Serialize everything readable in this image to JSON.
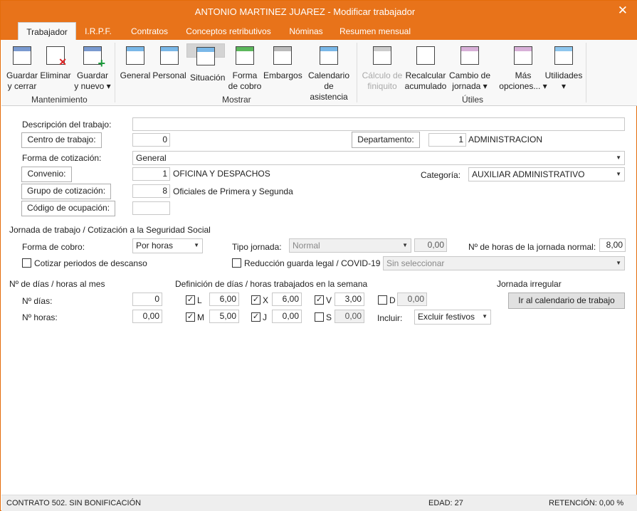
{
  "window": {
    "title": "ANTONIO MARTINEZ JUAREZ - Modificar trabajador",
    "close": "✕"
  },
  "tabs": [
    "Trabajador",
    "I.R.P.F.",
    "Contratos",
    "Conceptos retributivos",
    "Nóminas",
    "Resumen mensual"
  ],
  "ribbon": {
    "groups": [
      "Mantenimiento",
      "Mostrar",
      "Útiles"
    ],
    "buttons": [
      {
        "l1": "Guardar",
        "l2": "y cerrar"
      },
      {
        "l1": "Eliminar",
        "l2": ""
      },
      {
        "l1": "Guardar",
        "l2": "y nuevo ▾"
      },
      {
        "l1": "General",
        "l2": ""
      },
      {
        "l1": "Personal",
        "l2": ""
      },
      {
        "l1": "Situación",
        "l2": ""
      },
      {
        "l1": "Forma",
        "l2": "de cobro"
      },
      {
        "l1": "Embargos",
        "l2": ""
      },
      {
        "l1": "Calendario",
        "l2": "de asistencia"
      },
      {
        "l1": "Cálculo de",
        "l2": "finiquito"
      },
      {
        "l1": "Recalcular",
        "l2": "acumulado"
      },
      {
        "l1": "Cambio de",
        "l2": "jornada ▾"
      },
      {
        "l1": "Más",
        "l2": "opciones... ▾"
      },
      {
        "l1": "Utilidades",
        "l2": "▾"
      }
    ]
  },
  "form": {
    "descripcion_label": "Descripción del trabajo:",
    "descripcion_value": "",
    "centro_btn": "Centro de trabajo:",
    "centro_value": "0",
    "departamento_btn": "Departamento:",
    "departamento_value": "1",
    "departamento_name": "ADMINISTRACION",
    "forma_cot_label": "Forma de cotización:",
    "forma_cot_value": "General",
    "convenio_btn": "Convenio:",
    "convenio_value": "1",
    "convenio_name": "OFICINA Y DESPACHOS",
    "categoria_label": "Categoría:",
    "categoria_value": "AUXILIAR ADMINISTRATIVO",
    "grupo_btn": "Grupo de cotización:",
    "grupo_value": "8",
    "grupo_name": "Oficiales de Primera y Segunda",
    "ocupacion_btn": "Código de ocupación:",
    "ocupacion_value": ""
  },
  "jornada": {
    "heading": "Jornada de trabajo / Cotización a la Seguridad Social",
    "forma_cobro_label": "Forma de cobro:",
    "forma_cobro_value": "Por horas",
    "tipo_label": "Tipo jornada:",
    "tipo_value": "Normal",
    "tipo_hours": "0,00",
    "horas_normal_label": "Nº de horas de la jornada normal:",
    "horas_normal_value": "8,00",
    "cotizar_label": "Cotizar periodos de descanso",
    "cotizar_checked": false,
    "reduccion_label": "Reducción guarda legal / COVID-19",
    "reduccion_checked": false,
    "reduccion_select": "Sin seleccionar"
  },
  "mes": {
    "heading": "Nº de días / horas al mes",
    "dias_label": "Nº días:",
    "dias_value": "0",
    "horas_label": "Nº horas:",
    "horas_value": "0,00"
  },
  "semana": {
    "heading": "Definición de días / horas trabajados en la semana",
    "days": [
      {
        "d": "L",
        "checked": true,
        "v": "6,00"
      },
      {
        "d": "X",
        "checked": true,
        "v": "6,00"
      },
      {
        "d": "V",
        "checked": true,
        "v": "3,00"
      },
      {
        "d": "D",
        "checked": false,
        "v": "0,00"
      },
      {
        "d": "M",
        "checked": true,
        "v": "5,00"
      },
      {
        "d": "J",
        "checked": true,
        "v": "0,00"
      },
      {
        "d": "S",
        "checked": false,
        "v": "0,00"
      }
    ],
    "incluir_label": "Incluir:",
    "incluir_value": "Excluir festivos"
  },
  "irregular": {
    "heading": "Jornada irregular",
    "button": "Ir al calendario de trabajo"
  },
  "status": {
    "contrato": "CONTRATO 502.  SIN BONIFICACIÓN",
    "edad": "EDAD: 27",
    "retencion": "RETENCIÓN: 0,00 %"
  }
}
